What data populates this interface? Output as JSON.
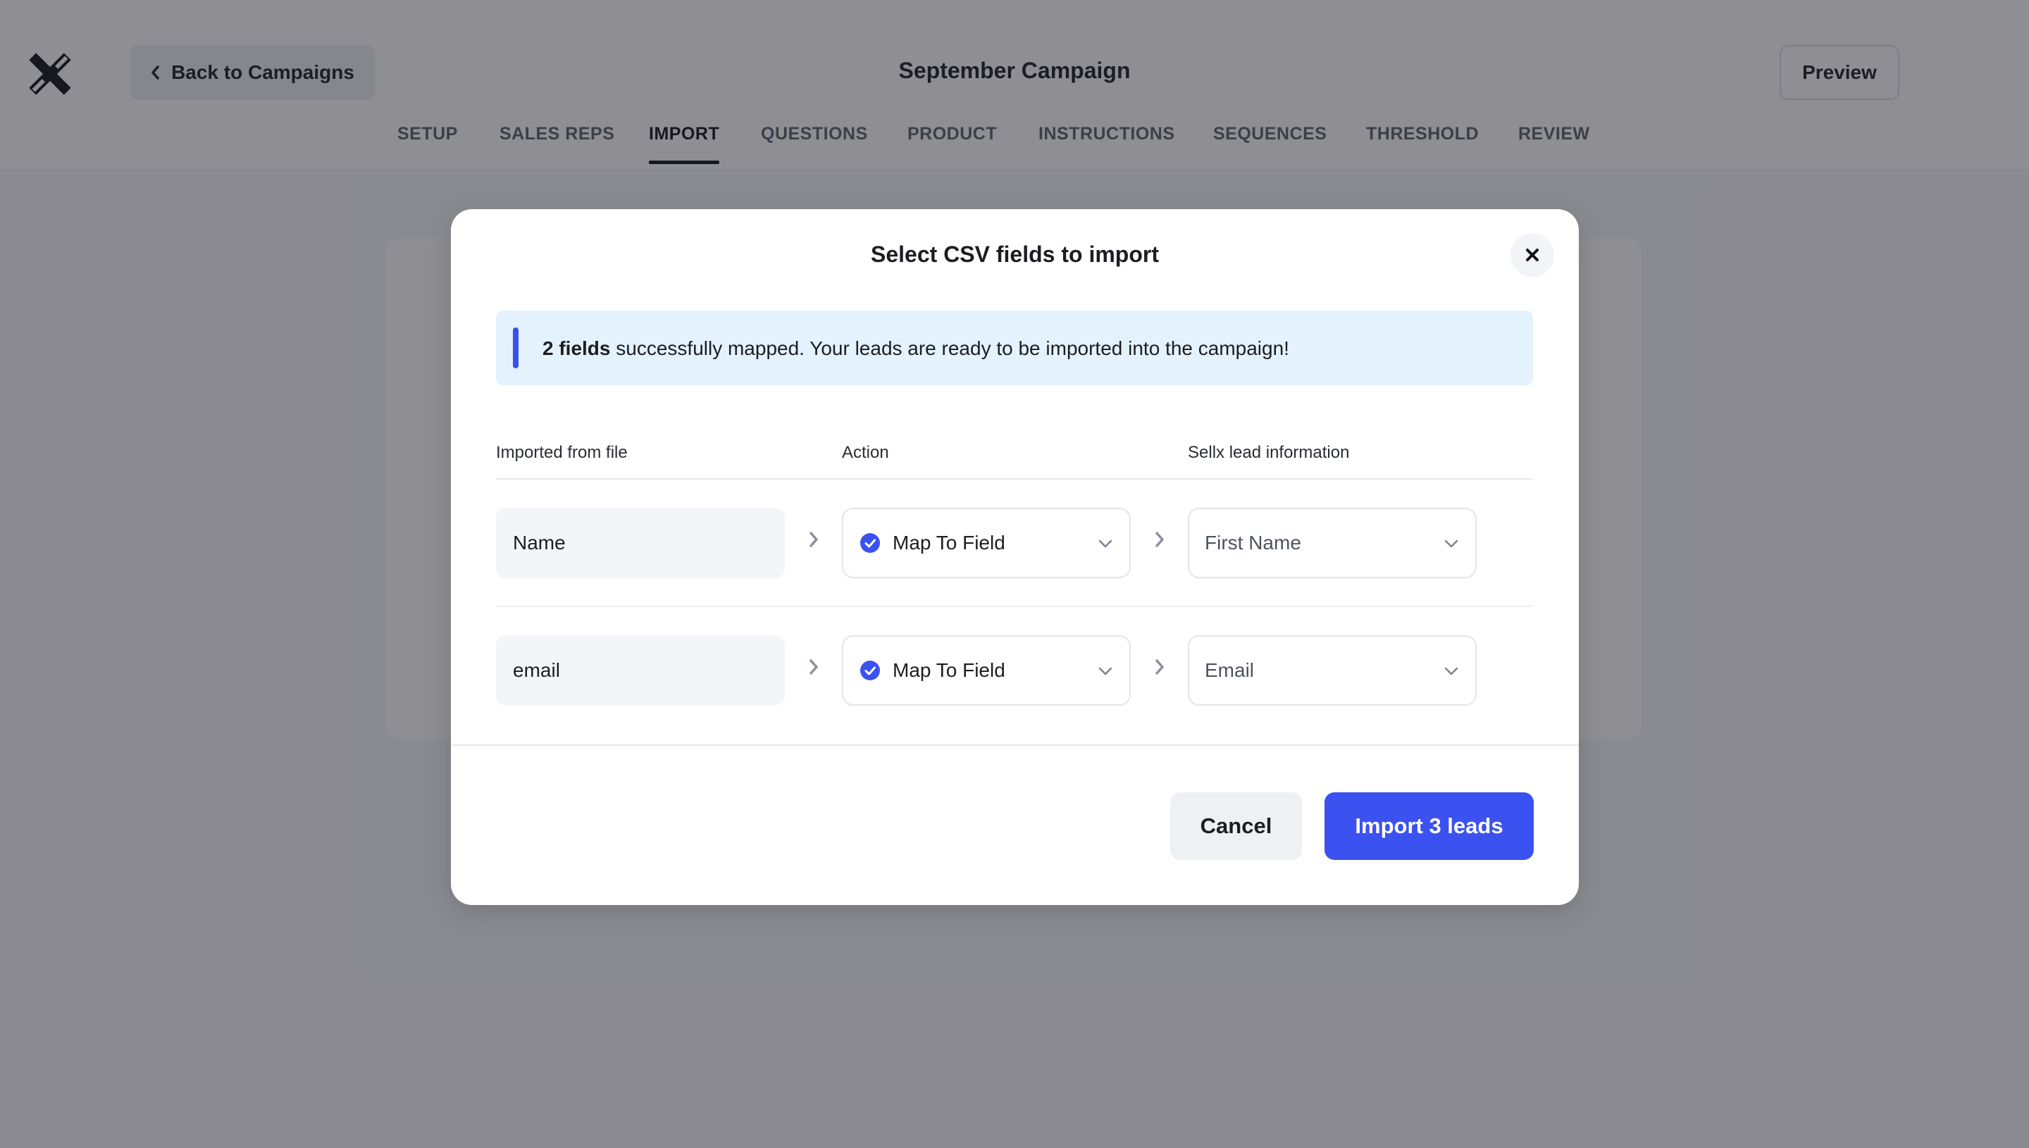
{
  "header": {
    "back_label": "Back to Campaigns",
    "title": "September Campaign",
    "preview_label": "Preview"
  },
  "tabs": [
    {
      "label": "SETUP",
      "active": false
    },
    {
      "label": "SALES REPS",
      "active": false
    },
    {
      "label": "IMPORT",
      "active": true
    },
    {
      "label": "QUESTIONS",
      "active": false
    },
    {
      "label": "PRODUCT",
      "active": false
    },
    {
      "label": "INSTRUCTIONS",
      "active": false
    },
    {
      "label": "SEQUENCES",
      "active": false
    },
    {
      "label": "THRESHOLD",
      "active": false
    },
    {
      "label": "REVIEW",
      "active": false
    }
  ],
  "modal": {
    "title": "Select CSV fields to import",
    "banner": {
      "bold": "2 fields",
      "text": " successfully mapped. Your leads are ready to be imported into the campaign!"
    },
    "columns": {
      "source": "Imported from file",
      "action": "Action",
      "target": "Sellx lead information"
    },
    "rows": [
      {
        "source": "Name",
        "action": "Map To Field",
        "target": "First Name"
      },
      {
        "source": "email",
        "action": "Map To Field",
        "target": "Email"
      }
    ],
    "cancel_label": "Cancel",
    "import_label": "Import 3 leads"
  },
  "colors": {
    "accent": "#3b52f0",
    "banner_bg": "#e3f2fc",
    "overlay": "rgba(29,29,39,0.5)"
  },
  "icons": {
    "logo": "sellx-logo-icon",
    "back": "chevron-left-icon",
    "close": "close-icon",
    "row_arrow": "chevron-right-icon",
    "check": "check-circle-icon",
    "dropdown": "chevron-down-icon"
  }
}
